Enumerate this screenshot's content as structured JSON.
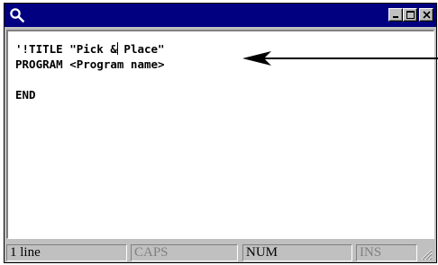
{
  "window": {
    "app_icon": "magnifier-icon",
    "controls": [
      "minimize-icon",
      "maximize-icon",
      "close-icon"
    ]
  },
  "editor": {
    "lines": [
      {
        "before_caret": "'!TITLE \"Pick &",
        "after_caret": " Place\""
      },
      {
        "text": "PROGRAM <Program name>"
      },
      {
        "text": ""
      },
      {
        "text": "END"
      }
    ],
    "annotation_icon": "arrow-left-icon"
  },
  "status_bar": {
    "lines": "1 line",
    "caps": "CAPS",
    "num": "NUM",
    "ins": "INS",
    "resize_icon": "resize-grip-icon"
  }
}
